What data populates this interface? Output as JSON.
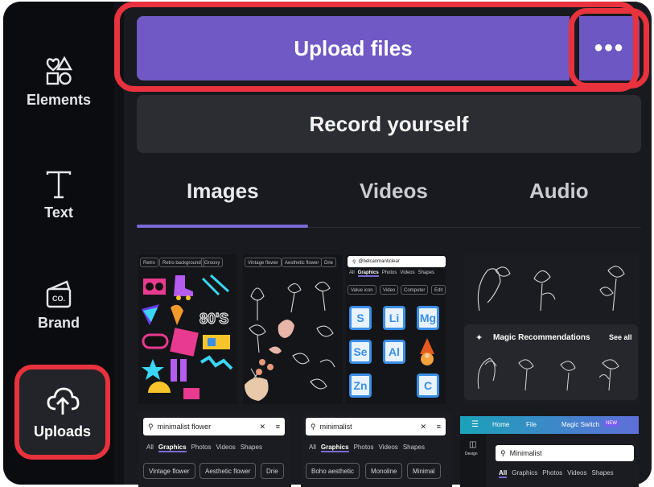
{
  "sidebar": {
    "items": [
      {
        "label": "Elements",
        "icon": "shapes-icon"
      },
      {
        "label": "Text",
        "icon": "text-icon"
      },
      {
        "label": "Brand",
        "icon": "brand-icon"
      },
      {
        "label": "Uploads",
        "icon": "cloud-upload-icon"
      }
    ]
  },
  "actions": {
    "upload_label": "Upload files",
    "more_label": "•••",
    "record_label": "Record yourself"
  },
  "tabs": [
    {
      "label": "Images",
      "active": true
    },
    {
      "label": "Videos",
      "active": false
    },
    {
      "label": "Audio",
      "active": false
    }
  ],
  "thumbnails": {
    "t1": {
      "chips": [
        "Retro",
        "Retro background",
        "Groovy"
      ],
      "badge": "80'S"
    },
    "t2": {
      "chips": [
        "Vintage flower",
        "Aesthetic flower",
        "Drie"
      ]
    },
    "t3": {
      "search": "@belcanmanticlear",
      "filters": [
        "All",
        "Graphics",
        "Photos",
        "Videos",
        "Shapes"
      ],
      "chips": [
        "Value icon",
        "Video",
        "Computer",
        "Edit"
      ],
      "tiles": [
        "S",
        "Li",
        "Mg",
        "Se",
        "Al",
        "Zn",
        "C"
      ]
    },
    "t4": {
      "magic_title": "Magic Recommendations",
      "see_all": "See all"
    },
    "t5": {
      "search": "minimalist flower",
      "filters": [
        "All",
        "Graphics",
        "Photos",
        "Videos",
        "Shapes"
      ],
      "chips": [
        "Vintage flower",
        "Aesthetic flower",
        "Drie"
      ]
    },
    "t6": {
      "search": "minimalist",
      "filters": [
        "All",
        "Graphics",
        "Photos",
        "Videos",
        "Shapes"
      ],
      "chips": [
        "Boho aesthetic",
        "Monoline",
        "Minimal"
      ]
    },
    "t7": {
      "menu": [
        "Home",
        "File",
        "Magic Switch"
      ],
      "new_badge": "NEW",
      "search": "Minimalist",
      "filters": [
        "All",
        "Graphics",
        "Photos",
        "Videos",
        "Shapes"
      ],
      "side_label": "Design"
    }
  },
  "colors": {
    "accent": "#7059c4",
    "highlight": "#e8323d",
    "panel": "#191a1f",
    "sidebar": "#0b0c10"
  }
}
